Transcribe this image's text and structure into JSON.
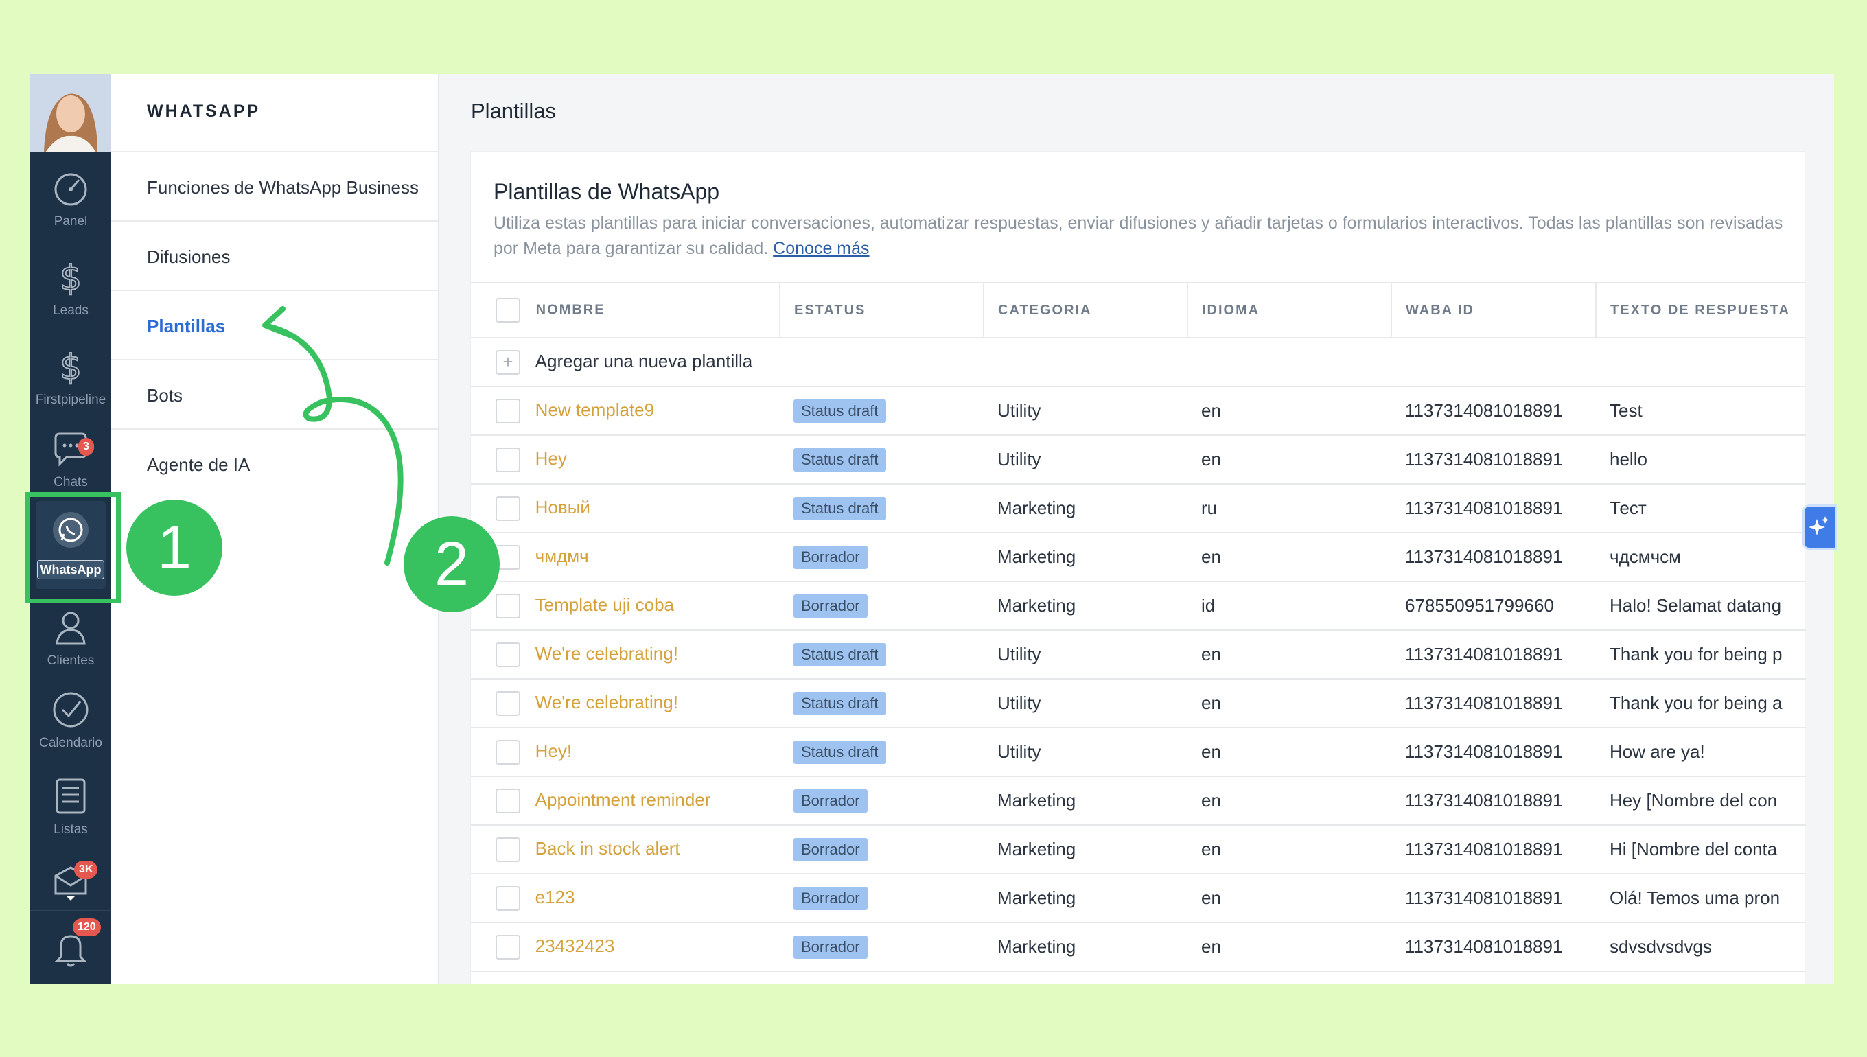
{
  "sidebar": {
    "items": [
      {
        "label": "Panel",
        "icon": "speedometer-icon"
      },
      {
        "label": "Leads",
        "icon": "dollar-icon"
      },
      {
        "label": "Firstpipeline",
        "icon": "dollar-icon"
      },
      {
        "label": "Chats",
        "icon": "chat-icon",
        "badge": "3"
      },
      {
        "label": "WhatsApp",
        "icon": "whatsapp-icon"
      },
      {
        "label": "Clientes",
        "icon": "contacts-icon"
      },
      {
        "label": "Calendario",
        "icon": "checkmark-icon"
      },
      {
        "label": "Listas",
        "icon": "list-icon"
      },
      {
        "label": "",
        "icon": "mail-icon",
        "badge": "3K"
      },
      {
        "label": "",
        "icon": "bell-icon",
        "badge": "120"
      }
    ]
  },
  "submenu": {
    "title": "WHATSAPP",
    "items": [
      {
        "label": "Funciones de WhatsApp Business"
      },
      {
        "label": "Difusiones"
      },
      {
        "label": "Plantillas",
        "active": true
      },
      {
        "label": "Bots"
      },
      {
        "label": "Agente de IA"
      }
    ]
  },
  "main": {
    "title": "Plantillas",
    "card_title": "Plantillas de WhatsApp",
    "card_desc": "Utiliza estas plantillas para iniciar conversaciones, automatizar respuestas, enviar difusiones y añadir tarjetas o formularios interactivos. Todas las plantillas son revisadas por Meta para garantizar su calidad.",
    "card_link": "Conoce más",
    "columns": [
      "NOMBRE",
      "ESTATUS",
      "CATEGORIA",
      "IDIOMA",
      "WABA ID",
      "TEXTO DE RESPUESTA"
    ],
    "add_row": "Agregar una nueva plantilla",
    "rows": [
      {
        "name": "New template9",
        "status": "Status draft",
        "category": "Utility",
        "lang": "en",
        "waba": "1137314081018891",
        "text": "Test"
      },
      {
        "name": "Hey",
        "status": "Status draft",
        "category": "Utility",
        "lang": "en",
        "waba": "1137314081018891",
        "text": "hello"
      },
      {
        "name": "Новый",
        "status": "Status draft",
        "category": "Marketing",
        "lang": "ru",
        "waba": "1137314081018891",
        "text": "Тест"
      },
      {
        "name": "чмдмч",
        "status": "Borrador",
        "category": "Marketing",
        "lang": "en",
        "waba": "1137314081018891",
        "text": "чдсмчсм"
      },
      {
        "name": "Template uji coba",
        "status": "Borrador",
        "category": "Marketing",
        "lang": "id",
        "waba": "678550951799660",
        "text": "Halo! Selamat datang"
      },
      {
        "name": "We're celebrating!",
        "status": "Status draft",
        "category": "Utility",
        "lang": "en",
        "waba": "1137314081018891",
        "text": "Thank you for being p"
      },
      {
        "name": "We're celebrating!",
        "status": "Status draft",
        "category": "Utility",
        "lang": "en",
        "waba": "1137314081018891",
        "text": "Thank you for being a"
      },
      {
        "name": "Hey!",
        "status": "Status draft",
        "category": "Utility",
        "lang": "en",
        "waba": "1137314081018891",
        "text": "How are ya!"
      },
      {
        "name": "Appointment reminder",
        "status": "Borrador",
        "category": "Marketing",
        "lang": "en",
        "waba": "1137314081018891",
        "text": "Hey [Nombre del con"
      },
      {
        "name": "Back in stock alert",
        "status": "Borrador",
        "category": "Marketing",
        "lang": "en",
        "waba": "1137314081018891",
        "text": "Hi [Nombre del conta"
      },
      {
        "name": "e123",
        "status": "Borrador",
        "category": "Marketing",
        "lang": "en",
        "waba": "1137314081018891",
        "text": "Olá! Temos uma pron"
      },
      {
        "name": "23432423",
        "status": "Borrador",
        "category": "Marketing",
        "lang": "en",
        "waba": "1137314081018891",
        "text": "sdvsdvsdvgs"
      }
    ]
  },
  "annotations": {
    "step1": "1",
    "step2": "2",
    "color": "#37c25f"
  },
  "colors": {
    "accent": "#2c6bd1",
    "sidebar": "#1d3146",
    "template_name": "#d4a13a",
    "status_bg": "#9fc3f0"
  }
}
